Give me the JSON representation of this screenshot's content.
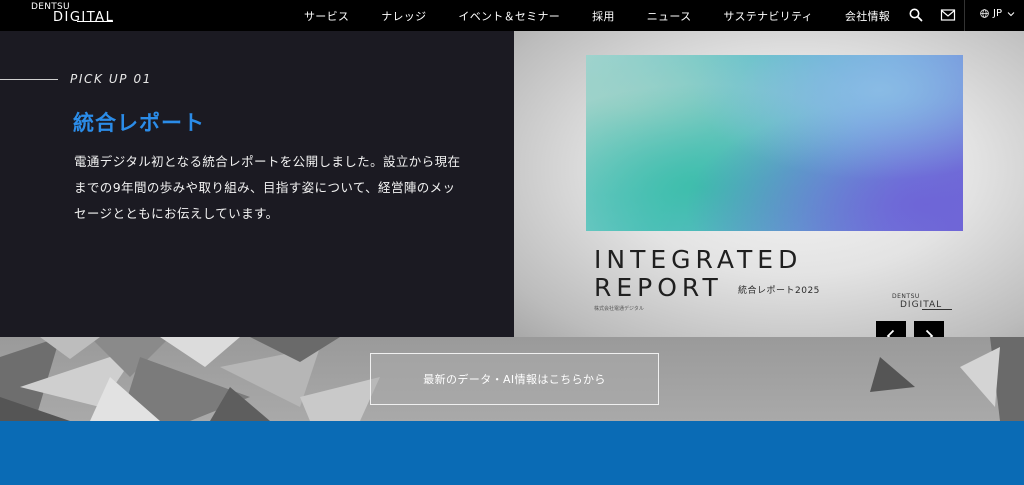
{
  "header": {
    "logo_top": "DENTSU",
    "logo_bottom": "DIGITAL",
    "nav": [
      {
        "label": "サービス"
      },
      {
        "label": "ナレッジ"
      },
      {
        "label": "イベント＆セミナー"
      },
      {
        "label": "採用"
      },
      {
        "label": "ニュース"
      },
      {
        "label": "サステナビリティ"
      },
      {
        "label": "会社情報"
      }
    ],
    "icons": {
      "search": "search-icon",
      "mail": "mail-icon",
      "globe": "globe-icon"
    },
    "lang": "JP"
  },
  "hero": {
    "pick_label": "PICK UP 01",
    "title": "統合レポート",
    "description": "電通デジタル初となる統合レポートを公開しました。設立から現在までの9年間の歩みや取り組み、目指す姿について、経営陣のメッセージとともにお伝えしています。",
    "image": {
      "line1": "INTEGRATED",
      "line2": "REPORT",
      "subtitle": "統合レポート2025",
      "company": "株式会社電通デジタル",
      "logo_top": "DENTSU",
      "logo_bottom": "DIGITAL"
    }
  },
  "carousel": {
    "prev_icon": "chevron-left-icon",
    "next_icon": "chevron-right-icon"
  },
  "cta": {
    "label": "最新のデータ・AI情報はこちらから"
  },
  "colors": {
    "accent_blue": "#2b8ce8",
    "section_blue": "#0a6bb5",
    "hero_dark": "#1b1a22"
  }
}
